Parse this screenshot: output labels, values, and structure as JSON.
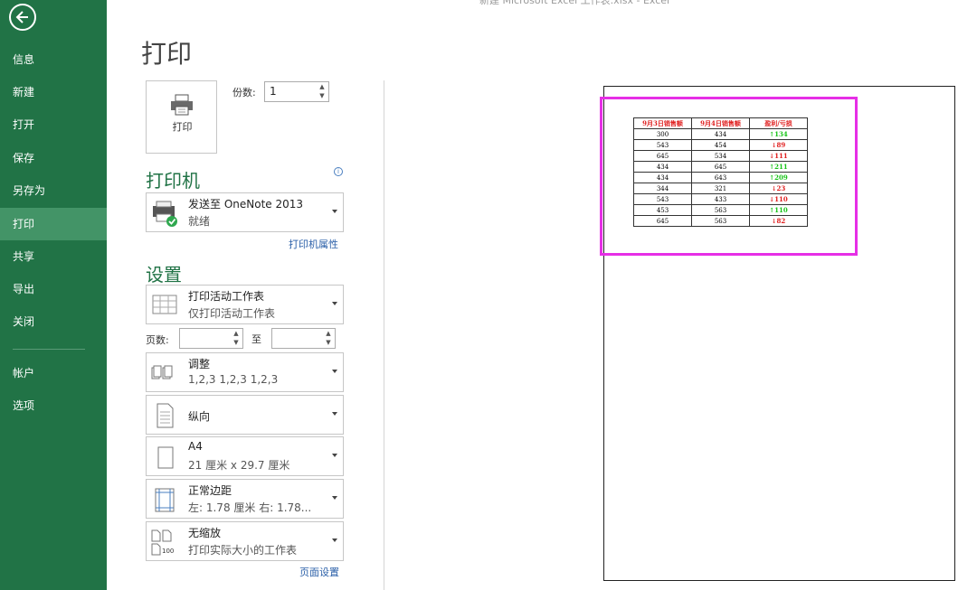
{
  "window": {
    "title_partial": "新建 Microsoft Excel 工作表.xlsx - Excel"
  },
  "nav": {
    "items": [
      {
        "label": "信息",
        "active": false
      },
      {
        "label": "新建",
        "active": false
      },
      {
        "label": "打开",
        "active": false
      },
      {
        "label": "保存",
        "active": false
      },
      {
        "label": "另存为",
        "active": false
      },
      {
        "label": "打印",
        "active": true
      },
      {
        "label": "共享",
        "active": false
      },
      {
        "label": "导出",
        "active": false
      },
      {
        "label": "关闭",
        "active": false
      }
    ],
    "bottom_items": [
      {
        "label": "帐户"
      },
      {
        "label": "选项"
      }
    ]
  },
  "page": {
    "title": "打印"
  },
  "print": {
    "button_label": "打印",
    "copies_label": "份数:",
    "copies_value": "1"
  },
  "printer": {
    "section_title": "打印机",
    "name": "发送至 OneNote 2013",
    "status": "就绪",
    "properties_link": "打印机属性",
    "info_icon": "i"
  },
  "settings": {
    "section_title": "设置",
    "what_to_print": {
      "primary": "打印活动工作表",
      "secondary": "仅打印活动工作表"
    },
    "pages_label": "页数:",
    "pages_to": "至",
    "collation": {
      "primary": "调整",
      "secondary": "1,2,3    1,2,3    1,2,3"
    },
    "orientation": {
      "primary": "纵向"
    },
    "paper": {
      "primary": "A4",
      "secondary": "21 厘米 x 29.7 厘米"
    },
    "margins": {
      "primary": "正常边距",
      "secondary": "左: 1.78 厘米    右: 1.78..."
    },
    "scaling": {
      "primary": "无缩放",
      "secondary": "打印实际大小的工作表",
      "icon_text": "100"
    },
    "page_setup_link": "页面设置"
  },
  "preview": {
    "headers": [
      "9月3日销售额",
      "9月4日销售额",
      "盈利/亏损"
    ],
    "rows": [
      [
        "300",
        "434",
        "↑134",
        "up"
      ],
      [
        "543",
        "454",
        "↓89",
        "down"
      ],
      [
        "645",
        "534",
        "↓111",
        "down"
      ],
      [
        "434",
        "645",
        "↑211",
        "up"
      ],
      [
        "434",
        "643",
        "↑209",
        "up"
      ],
      [
        "344",
        "321",
        "↓23",
        "down"
      ],
      [
        "543",
        "433",
        "↓110",
        "down"
      ],
      [
        "453",
        "563",
        "↑110",
        "up"
      ],
      [
        "645",
        "563",
        "↓82",
        "down"
      ]
    ],
    "colors": {
      "nav_green": "#217346",
      "highlight": "#e62fe6",
      "up": "#18c418",
      "down": "#e02020"
    }
  }
}
